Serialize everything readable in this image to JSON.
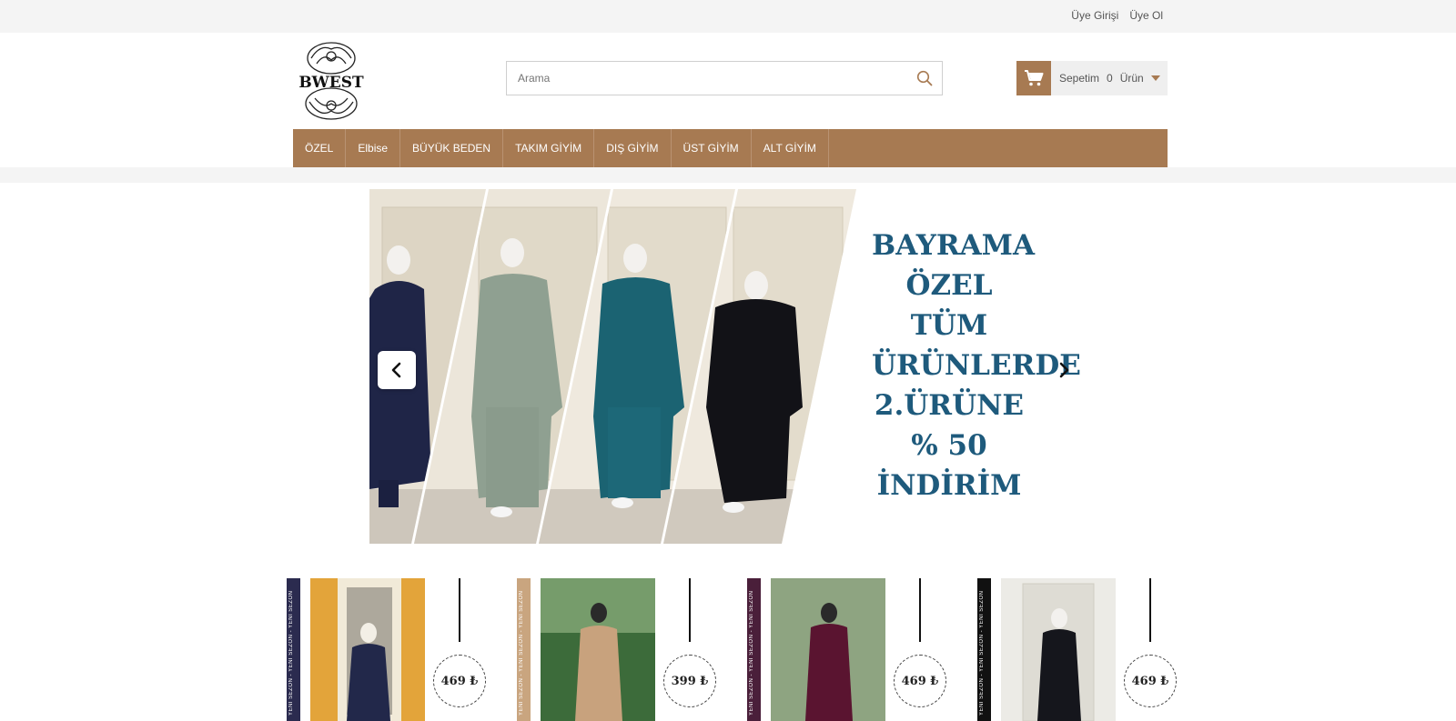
{
  "topbar": {
    "login": "Üye Girişi",
    "register": "Üye Ol"
  },
  "logo": {
    "text": "BWEST"
  },
  "search": {
    "placeholder": "Arama"
  },
  "cart": {
    "label": "Sepetim",
    "count": "0",
    "unit": "Ürün"
  },
  "nav": {
    "items": [
      "ÖZEL",
      "Elbise",
      "BÜYÜK BEDEN",
      "TAKIM GİYİM",
      "DIŞ GİYİM",
      "ÜST GİYİM",
      "ALT GİYİM"
    ]
  },
  "banner": {
    "lines": [
      "BAYRAMA",
      "ÖZEL",
      "TÜM",
      "ÜRÜNLERDE",
      "2.ÜRÜNE",
      "% 50",
      "İNDİRİM"
    ]
  },
  "products": [
    {
      "tag": "YENİ SEZON - YENİ SEZON - YENİ SEZON",
      "price": "469 ₺",
      "bar_color": "#2b2b4f",
      "outfit_color": "#22284a"
    },
    {
      "tag": "YENİ SEZON - YENİ SEZON - YENİ SEZON",
      "price": "399 ₺",
      "bar_color": "#c9a57f",
      "outfit_color": "#c8a27d"
    },
    {
      "tag": "YENİ SEZON - YENİ SEZON - YENİ SEZON",
      "price": "469 ₺",
      "bar_color": "#4a1f3a",
      "outfit_color": "#5a1430"
    },
    {
      "tag": "YENİ SEZON - YENİ SEZON - YENİ SEZON",
      "price": "469 ₺",
      "bar_color": "#111111",
      "outfit_color": "#15161c"
    }
  ],
  "colors": {
    "accent": "#a77a52",
    "banner_text": "#1e5a7c"
  }
}
